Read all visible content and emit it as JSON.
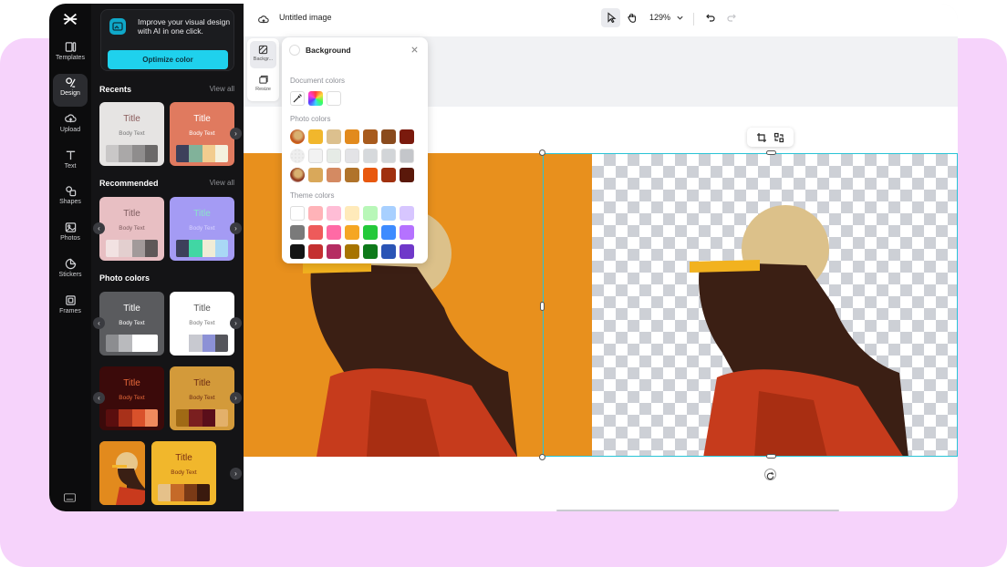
{
  "app": {
    "title": "Untitled image",
    "zoom": "129%"
  },
  "nav": {
    "items": [
      {
        "label": "Templates",
        "icon": "templates-icon"
      },
      {
        "label": "Design",
        "icon": "design-icon",
        "active": true
      },
      {
        "label": "Upload",
        "icon": "upload-icon"
      },
      {
        "label": "Text",
        "icon": "text-icon"
      },
      {
        "label": "Shapes",
        "icon": "shapes-icon"
      },
      {
        "label": "Photos",
        "icon": "photos-icon"
      },
      {
        "label": "Stickers",
        "icon": "stickers-icon"
      },
      {
        "label": "Frames",
        "icon": "frames-icon"
      }
    ]
  },
  "panel": {
    "promo_text": "Improve your visual design with AI in one click.",
    "promo_button": "Optimize color",
    "recents_title": "Recents",
    "recommended_title": "Recommended",
    "photo_colors_title": "Photo colors",
    "view_all": "View all",
    "card_title": "Title",
    "card_body": "Body Text",
    "recents": [
      {
        "bg": "#e6e4e3",
        "title_color": "#8a5a5a",
        "body_color": "#777777",
        "swatches": [
          "#c9c7c7",
          "#aaa8a8",
          "#8f8d8d",
          "#6b6969"
        ]
      },
      {
        "bg": "#e07a5f",
        "title_color": "#ffffff",
        "body_color": "#ffffff",
        "swatches": [
          "#3d405b",
          "#81b29a",
          "#f2cc8f",
          "#f4f1de"
        ]
      }
    ],
    "recommended": [
      {
        "bg": "#e8bfc3",
        "title_color": "#7d5c5f",
        "body_color": "#7d5c5f",
        "swatches": [
          "#f2e2e2",
          "#e3cfcf",
          "#a29a9a",
          "#5e5858"
        ]
      },
      {
        "bg": "#a49bf4",
        "title_color": "#8ae3c9",
        "body_color": "#d9d4ff",
        "swatches": [
          "#3d405b",
          "#41d6a4",
          "#f0ecd6",
          "#a9d8f5"
        ]
      }
    ],
    "photo_cards": [
      {
        "bg": "#5a5b5e",
        "title_color": "#ffffff",
        "body_color": "#ffffff",
        "swatches": [
          "#8c8d90",
          "#b9babd",
          "#ffffff",
          "#ffffff"
        ]
      },
      {
        "bg": "#ffffff",
        "title_color": "#555555",
        "body_color": "#777777",
        "swatches": [
          "#ffffff",
          "#c8c9d0",
          "#8c91d6",
          "#55565c"
        ]
      },
      {
        "bg": "#3b0a0a",
        "title_color": "#e96a3a",
        "body_color": "#e96a3a",
        "swatches": [
          "#5a0e0e",
          "#a8311a",
          "#d9512b",
          "#f08a5d"
        ]
      },
      {
        "bg": "#d39a3a",
        "title_color": "#6b2a13",
        "body_color": "#6b2a13",
        "swatches": [
          "#a06a15",
          "#7a1f1f",
          "#5a0e1a",
          "#e3b06a"
        ]
      },
      {
        "bg": "#f1b72c",
        "title_color": "#7a2e12",
        "body_color": "#7a2e12",
        "swatches": [
          "#e5c18a",
          "#c56a28",
          "#7a3a16",
          "#3a1a0e"
        ]
      }
    ]
  },
  "popover": {
    "title": "Background",
    "document_colors_label": "Document colors",
    "photo_colors_label": "Photo colors",
    "theme_colors_label": "Theme colors",
    "photo_colors_row1": [
      "#f1b72c",
      "#dcc08e",
      "#e28a1d",
      "#a85b1d",
      "#8a4b1d",
      "#7a1a0d"
    ],
    "photo_colors_row2": [
      "#f2f2f2",
      "#e6ebe6",
      "#e3e3e6",
      "#d6d9dc",
      "#d2d5d8",
      "#c4c6ca"
    ],
    "photo_colors_row3": [
      "#d9a85a",
      "#d48a62",
      "#b0732a",
      "#e8580e",
      "#a0300e",
      "#5a180a"
    ],
    "theme_row1": [
      "#ffffff",
      "#ffb3b8",
      "#ffbdd6",
      "#ffeaba",
      "#b8f7b8",
      "#a8d0ff",
      "#d7c6ff"
    ],
    "theme_row2": [
      "#7a7a7a",
      "#ee5a5a",
      "#ff6aa5",
      "#f5a623",
      "#24c93a",
      "#3d8bff",
      "#b572ff"
    ],
    "theme_row3": [
      "#141414",
      "#c43030",
      "#b52d62",
      "#a77400",
      "#0e7a1a",
      "#2a54b5",
      "#6f38c9"
    ]
  },
  "sidetools": [
    {
      "label": "Backgr...",
      "icon": "background-icon"
    },
    {
      "label": "Resize",
      "icon": "resize-icon"
    }
  ]
}
